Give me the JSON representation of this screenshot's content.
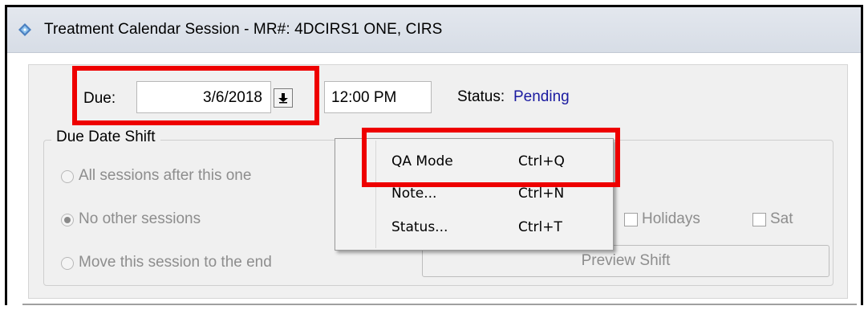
{
  "window": {
    "title": "Treatment Calendar Session - MR#: 4DCIRS1   ONE, CIRS"
  },
  "due": {
    "label": "Due:",
    "date": "3/6/2018",
    "time": "12:00 PM",
    "dropdown_icon": "down-arrow-icon"
  },
  "status": {
    "label": "Status:",
    "value": "Pending",
    "color": "#1a1aa0"
  },
  "due_date_shift": {
    "title": "Due Date Shift",
    "options": [
      {
        "label": "All sessions after this one",
        "selected": false
      },
      {
        "label": "No other sessions",
        "selected": true
      },
      {
        "label": "Move this session to the end",
        "selected": false
      }
    ],
    "holidays_label": "Holidays",
    "sat_label": "Sat",
    "preview_button": "Preview Shift"
  },
  "context_menu": {
    "items": [
      {
        "label": "QA Mode",
        "shortcut": "Ctrl+Q"
      },
      {
        "label": "Note...",
        "shortcut": "Ctrl+N"
      },
      {
        "label": "Status...",
        "shortcut": "Ctrl+T"
      }
    ]
  },
  "colors": {
    "highlight": "#ee0000",
    "panel_bg": "#f0f0f0",
    "disabled_text": "#8d8d8d"
  }
}
